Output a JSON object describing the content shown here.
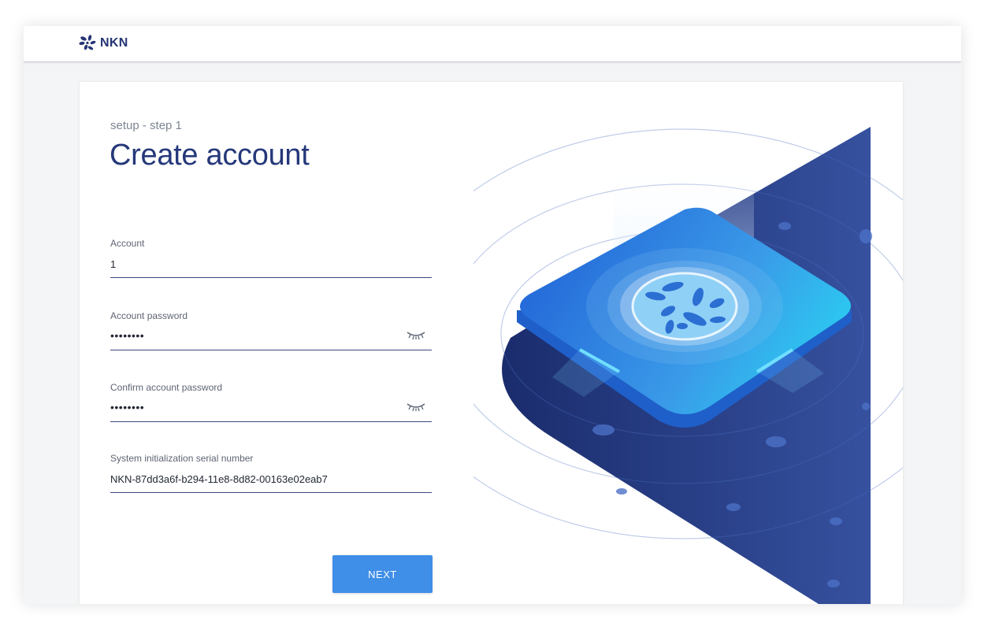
{
  "header": {
    "brand": "NKN",
    "logo_icon": "nkn-flower-logo-icon"
  },
  "form": {
    "step_label": "setup - step 1",
    "title": "Create account",
    "fields": [
      {
        "label": "Account",
        "value": "1"
      },
      {
        "label": "Account password",
        "value": "••••••••",
        "icon": "eye-closed-icon"
      },
      {
        "label": "Confirm account password",
        "value": "••••••••",
        "icon": "eye-closed-icon"
      },
      {
        "label": "System initialization serial number",
        "value": "NKN-87dd3a6f-b294-11e8-8d82-00163e02eab7"
      }
    ],
    "next_label": "NEXT"
  },
  "colors": {
    "brand_navy": "#253575",
    "button_blue": "#3f8fe8",
    "illustration_dark": "#1e3375",
    "illustration_light": "#2ad0f2"
  }
}
